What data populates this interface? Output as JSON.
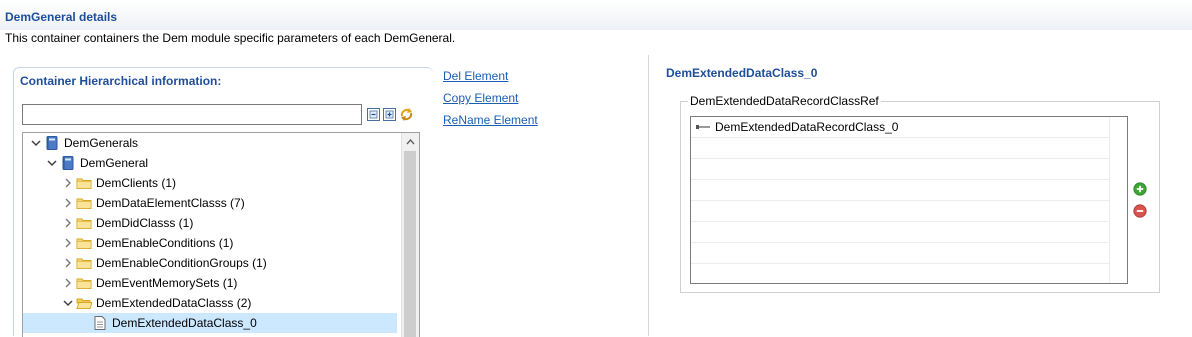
{
  "header": {
    "title": "DemGeneral details",
    "description": "This container containers the Dem module specific parameters of each DemGeneral."
  },
  "hierarchy": {
    "title": "Container Hierarchical information:",
    "filter": {
      "value": "",
      "placeholder": ""
    },
    "tree": [
      {
        "label": "DemGenerals",
        "icon": "book-icon",
        "expanded": true
      },
      {
        "label": "DemGeneral",
        "icon": "book-icon",
        "expanded": true
      },
      {
        "label": "DemClients (1)",
        "icon": "folder-icon",
        "expanded": false
      },
      {
        "label": "DemDataElementClasss (7)",
        "icon": "folder-icon",
        "expanded": false
      },
      {
        "label": "DemDidClasss (1)",
        "icon": "folder-icon",
        "expanded": false
      },
      {
        "label": "DemEnableConditions (1)",
        "icon": "folder-icon",
        "expanded": false
      },
      {
        "label": "DemEnableConditionGroups (1)",
        "icon": "folder-icon",
        "expanded": false
      },
      {
        "label": "DemEventMemorySets (1)",
        "icon": "folder-icon",
        "expanded": false
      },
      {
        "label": "DemExtendedDataClasss (2)",
        "icon": "folder-open-icon",
        "expanded": true
      },
      {
        "label": "DemExtendedDataClass_0",
        "icon": "document-icon",
        "selected": true
      }
    ]
  },
  "actions": {
    "del": "Del Element",
    "copy": "Copy Element",
    "rename": "ReName Element"
  },
  "details": {
    "title": "DemExtendedDataClass_0",
    "group_label": "DemExtendedDataRecordClassRef",
    "items": [
      {
        "label": "DemExtendedDataRecordClass_0",
        "icon": "reference-icon"
      }
    ]
  },
  "colors": {
    "title_blue": "#1f4e99",
    "link_blue": "#1a5fb4",
    "selection": "#cce8ff",
    "add_green": "#3fa535",
    "remove_red": "#d9534f"
  }
}
